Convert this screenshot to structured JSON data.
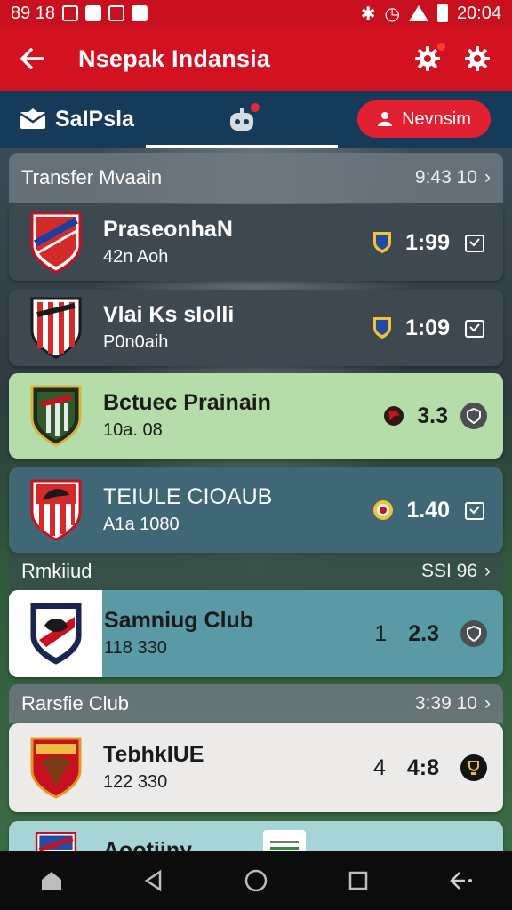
{
  "status": {
    "time": "20:04",
    "left_text": "89 18"
  },
  "app_bar": {
    "title": "Nsepak Indansia"
  },
  "tabs": {
    "tab1_label": "SaIPsla",
    "pill_label": "Nevnsim"
  },
  "sections": [
    {
      "title": "Transfer Mvaain",
      "meta": "9:43 10",
      "cards": [
        {
          "name": "PraseonhaN",
          "sub": "42n Aoh",
          "score": "1:99",
          "style": "dark"
        },
        {
          "name": "Vlai Ks sIolli",
          "sub": "P0n0aih",
          "score": "1:09",
          "style": "dark"
        },
        {
          "name": "Bctuec Prainain",
          "sub": "10a. 08",
          "score": "3.3",
          "style": "green"
        },
        {
          "name": "TEIULE CIOAUB",
          "sub": "A1a 1080",
          "score": "1.40",
          "style": "teal"
        }
      ]
    },
    {
      "title": "Rmkiiud",
      "meta": "SSI 96",
      "cards": [
        {
          "name": "Samniug Club",
          "sub": "118 330",
          "num": "1",
          "score": "2.3",
          "style": "split"
        }
      ]
    },
    {
      "title": "Rarsfie Club",
      "meta": "3:39 10",
      "cards": [
        {
          "name": "TebhkIUE",
          "sub": "122 330",
          "num": "4",
          "score": "4:8",
          "style": "white"
        },
        {
          "name": "Aootiiny",
          "style": "light-teal"
        }
      ]
    }
  ],
  "colors": {
    "brand_red": "#d31221",
    "tab_blue": "#163a5a",
    "green_card": "#b6dcaa"
  }
}
